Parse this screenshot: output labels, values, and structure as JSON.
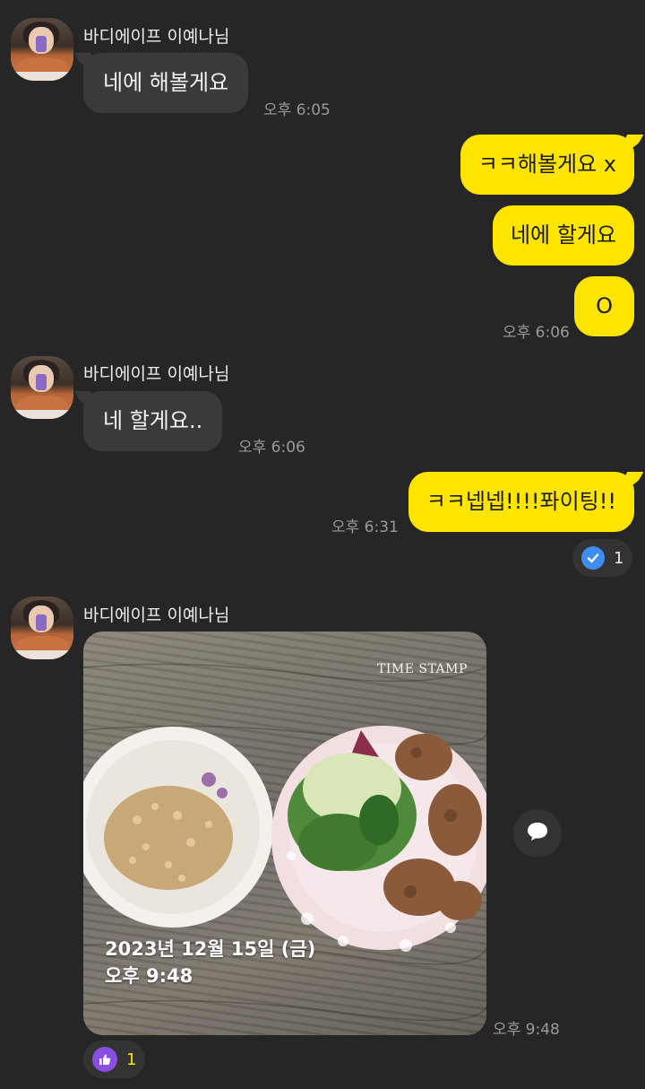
{
  "chat": {
    "sender_name": "바디에이프 이예나님",
    "messages": [
      {
        "direction": "in",
        "text": "네에 해볼게요",
        "time": "오후 6:05"
      },
      {
        "direction": "out",
        "text": "ㅋㅋ해볼게요 x"
      },
      {
        "direction": "out",
        "text": "네에 할게요"
      },
      {
        "direction": "out",
        "text": "O",
        "time": "오후 6:06"
      },
      {
        "direction": "in",
        "text": "네 할게요..",
        "time": "오후 6:06"
      },
      {
        "direction": "out",
        "text": "ㅋㅋ넵넵!!!!퐈이팅!!",
        "time": "오후 6:31",
        "reaction": {
          "icon": "check-icon",
          "count": "1"
        }
      },
      {
        "direction": "in",
        "type": "photo",
        "time": "오후 9:48",
        "reaction": {
          "icon": "thumbs-up-icon",
          "count": "1"
        },
        "photo": {
          "stamp_logo": "TIME STAMP",
          "date_text": "2023년 12월 15일 (금)",
          "time_text": "오후 9:48"
        }
      }
    ]
  },
  "colors": {
    "background": "#262626",
    "incoming_bubble": "#3a3a3a",
    "outgoing_bubble": "#fee500",
    "check_badge": "#3d8ef0",
    "thumb_badge": "#8a4fe0"
  },
  "icons": {
    "share": "speech-bubble-icon",
    "check": "check-icon",
    "thumb": "thumbs-up-icon"
  }
}
